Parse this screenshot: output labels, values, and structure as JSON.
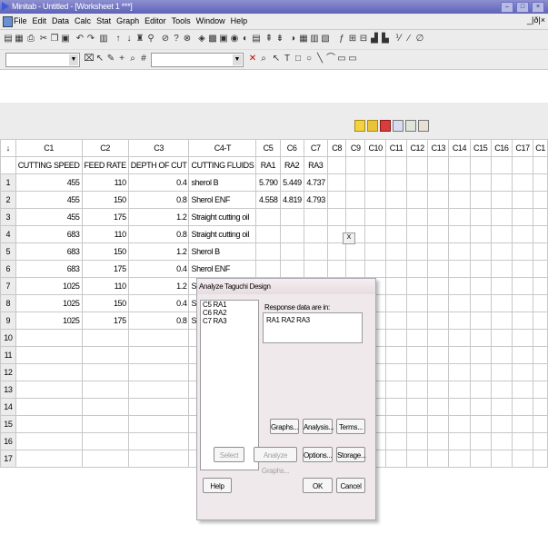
{
  "window": {
    "title": "Minitab - Untitled - [Worksheet 1 ***]"
  },
  "menu": [
    "File",
    "Edit",
    "Data",
    "Calc",
    "Stat",
    "Graph",
    "Editor",
    "Tools",
    "Window",
    "Help"
  ],
  "menu_mdi": "_|ð|×",
  "columns": {
    "ids": [
      "C1",
      "C2",
      "C3",
      "C4-T",
      "C5",
      "C6",
      "C7",
      "C8",
      "C9",
      "C10",
      "C11",
      "C12",
      "C13",
      "C14",
      "C15",
      "C16",
      "C17",
      "C1"
    ],
    "names": [
      "CUTTING SPEED",
      "FEED RATE",
      "DEPTH OF CUT",
      "CUTTING FLUIDS",
      "RA1",
      "RA2",
      "RA3",
      "",
      "",
      "",
      "",
      "",
      "",
      "",
      "",
      "",
      "",
      ""
    ]
  },
  "rows": [
    {
      "n": "1",
      "c1": "455",
      "c2": "110",
      "c3": "0.4",
      "c4": "sherol B",
      "c5": "5.790",
      "c6": "5.449",
      "c7": "4.737"
    },
    {
      "n": "2",
      "c1": "455",
      "c2": "150",
      "c3": "0.8",
      "c4": "Sherol ENF",
      "c5": "4.558",
      "c6": "4.819",
      "c7": "4.793"
    },
    {
      "n": "3",
      "c1": "455",
      "c2": "175",
      "c3": "1.2",
      "c4": "Straight cutting oil",
      "c5": "",
      "c6": "",
      "c7": ""
    },
    {
      "n": "4",
      "c1": "683",
      "c2": "110",
      "c3": "0.8",
      "c4": "Straight cutting oil",
      "c5": "",
      "c6": "",
      "c7": ""
    },
    {
      "n": "5",
      "c1": "683",
      "c2": "150",
      "c3": "1.2",
      "c4": "Sherol B",
      "c5": "",
      "c6": "",
      "c7": ""
    },
    {
      "n": "6",
      "c1": "683",
      "c2": "175",
      "c3": "0.4",
      "c4": "Sherol ENF",
      "c5": "",
      "c6": "",
      "c7": ""
    },
    {
      "n": "7",
      "c1": "1025",
      "c2": "110",
      "c3": "1.2",
      "c4": "Sherol ENF",
      "c5": "",
      "c6": "",
      "c7": ""
    },
    {
      "n": "8",
      "c1": "1025",
      "c2": "150",
      "c3": "0.4",
      "c4": "Straight cutting oil",
      "c5": "",
      "c6": "",
      "c7": ""
    },
    {
      "n": "9",
      "c1": "1025",
      "c2": "175",
      "c3": "0.8",
      "c4": "Sherol B",
      "c5": "",
      "c6": "",
      "c7": ""
    },
    {
      "n": "10",
      "c1": "",
      "c2": "",
      "c3": "",
      "c4": "",
      "c5": "",
      "c6": "",
      "c7": ""
    },
    {
      "n": "11",
      "c1": "",
      "c2": "",
      "c3": "",
      "c4": "",
      "c5": "",
      "c6": "",
      "c7": ""
    },
    {
      "n": "12",
      "c1": "",
      "c2": "",
      "c3": "",
      "c4": "",
      "c5": "",
      "c6": "",
      "c7": ""
    },
    {
      "n": "13",
      "c1": "",
      "c2": "",
      "c3": "",
      "c4": "",
      "c5": "",
      "c6": "",
      "c7": ""
    },
    {
      "n": "14",
      "c1": "",
      "c2": "",
      "c3": "",
      "c4": "",
      "c5": "",
      "c6": "",
      "c7": ""
    },
    {
      "n": "15",
      "c1": "",
      "c2": "",
      "c3": "",
      "c4": "",
      "c5": "",
      "c6": "",
      "c7": ""
    },
    {
      "n": "16",
      "c1": "",
      "c2": "",
      "c3": "",
      "c4": "",
      "c5": "",
      "c6": "",
      "c7": ""
    },
    {
      "n": "17",
      "c1": "",
      "c2": "",
      "c3": "",
      "c4": "",
      "c5": "",
      "c6": "",
      "c7": ""
    }
  ],
  "dialog": {
    "title": "Analyze Taguchi Design",
    "close": "X",
    "variables": [
      "C5  RA1",
      "C6  RA2",
      "C7  RA3"
    ],
    "response_label": "Response data are in:",
    "response_value": "RA1 RA2 RA3",
    "buttons": {
      "graphs": "Graphs...",
      "analysis": "Analysis...",
      "terms": "Terms...",
      "select": "Select",
      "analyze_graphs": "Analyze Graphs...",
      "options": "Options...",
      "storage": "Storage...",
      "help": "Help",
      "ok": "OK",
      "cancel": "Cancel"
    }
  },
  "colors": {
    "titlebar": "#6f73c4",
    "chrome": "#ececec",
    "dialog_bg": "#f0e9ec"
  }
}
